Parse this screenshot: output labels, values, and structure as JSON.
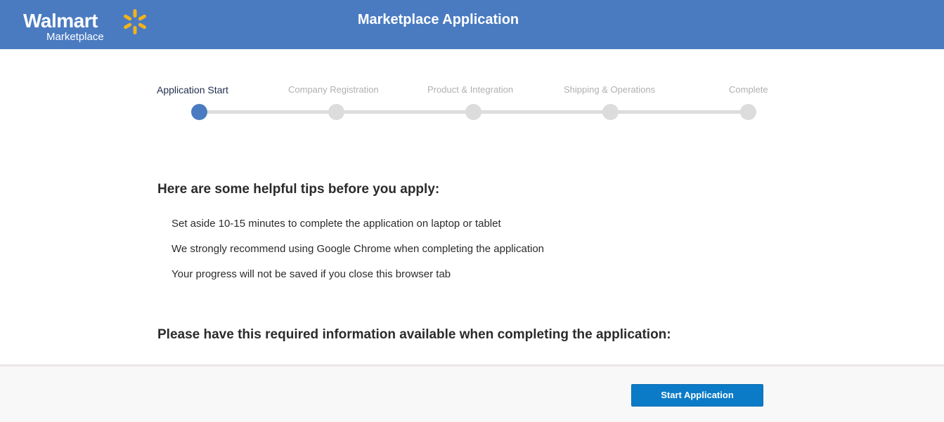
{
  "header": {
    "logo_word": "Walmart",
    "logo_sub": "Marketplace",
    "title": "Marketplace Application",
    "bg_color": "#4a7bc1",
    "spark_color": "#f2b31b"
  },
  "progress": {
    "steps": [
      {
        "label": "Application Start",
        "active": true
      },
      {
        "label": "Company Registration",
        "active": false
      },
      {
        "label": "Product & Integration",
        "active": false
      },
      {
        "label": "Shipping & Operations",
        "active": false
      },
      {
        "label": "Complete",
        "active": false
      }
    ],
    "current_step": 1,
    "total_steps": 5
  },
  "content": {
    "tips_heading": "Here are some helpful tips before you apply:",
    "tips": [
      "Set aside 10-15 minutes to complete the application on laptop or tablet",
      "We strongly recommend using Google Chrome when completing the application",
      "Your progress will not be saved if you close this browser tab"
    ],
    "required_heading": "Please have this required information available when completing the application:"
  },
  "footer": {
    "start_button": "Start Application",
    "button_color": "#0b7bc7"
  }
}
